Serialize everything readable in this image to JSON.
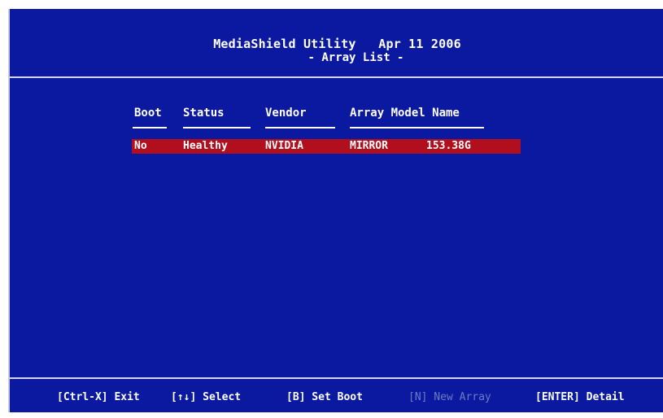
{
  "header": {
    "title": "MediaShield Utility   Apr 11 2006",
    "subtitle": "- Array List -"
  },
  "table": {
    "columns": [
      "Boot",
      "Status",
      "Vendor",
      "Array Model Name"
    ],
    "rows": [
      {
        "boot": "No",
        "status": "Healthy",
        "vendor": "NVIDIA",
        "model": "MIRROR",
        "size": "153.38G",
        "selected": true
      }
    ]
  },
  "footer": {
    "keys": [
      {
        "label": "[Ctrl-X] Exit",
        "enabled": true
      },
      {
        "label": "[↑↓] Select",
        "enabled": true
      },
      {
        "label": "[B] Set Boot",
        "enabled": true
      },
      {
        "label": "[N] New Array",
        "enabled": false
      },
      {
        "label": "[ENTER] Detail",
        "enabled": true
      }
    ]
  },
  "colors": {
    "background": "#0a19a0",
    "highlight": "#b10e1e",
    "text": "#ffffff",
    "disabled_text": "#6d7bc0"
  }
}
